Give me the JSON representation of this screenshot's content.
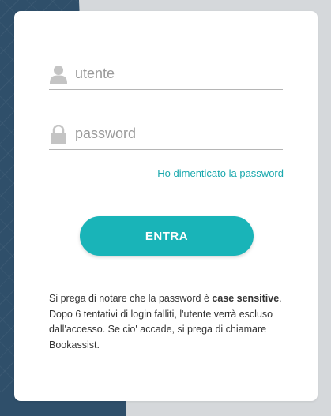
{
  "login": {
    "username_placeholder": "utente",
    "password_placeholder": "password",
    "forgot_link": "Ho dimenticato la password",
    "submit_label": "ENTRA",
    "note_prefix": "Si prega di notare che la password è ",
    "note_bold": "case sensitive",
    "note_suffix": ". Dopo 6 tentativi di login falliti, l'utente verrà escluso dall'accesso. Se cio' accade, si prega di chiamare Bookassist."
  },
  "colors": {
    "accent": "#19b4b8",
    "link": "#19a8ad",
    "background_dark": "#2f4f6a",
    "background_light": "#d5d8db"
  },
  "icons": [
    "user-icon",
    "lock-icon"
  ]
}
